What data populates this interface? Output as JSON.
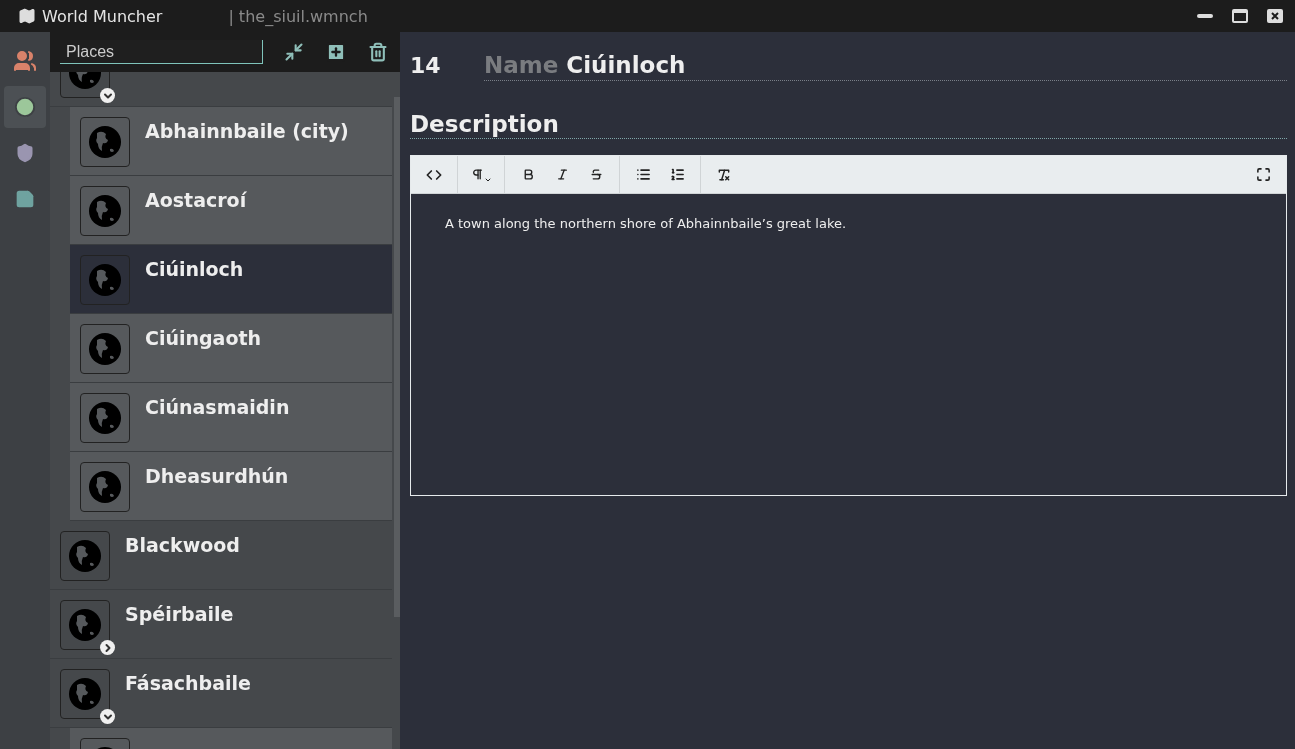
{
  "window": {
    "app_name": "World Muncher",
    "file_name": "| the_siuil.wmnch"
  },
  "rail": [
    {
      "kind": "people",
      "selected": false
    },
    {
      "kind": "places",
      "selected": true
    },
    {
      "kind": "factions",
      "selected": false
    },
    {
      "kind": "notes",
      "selected": false
    }
  ],
  "panel": {
    "search": {
      "value": "Places"
    }
  },
  "places": [
    {
      "expanded": true,
      "selected": false,
      "children": [
        {
          "name": "Abhainnbaile (city)",
          "selected": false
        },
        {
          "name": "Aostacroí",
          "selected": false
        },
        {
          "name": "Ciúinloch",
          "selected": true
        },
        {
          "name": "Ciúingaoth",
          "selected": false
        },
        {
          "name": "Ciúnasmaidin",
          "selected": false
        },
        {
          "name": "Dheasurdhún",
          "selected": false
        }
      ]
    },
    {
      "name": "Blackwood",
      "selected": false
    },
    {
      "name": "Spéirbaile",
      "expanded": false,
      "selected": false
    },
    {
      "name": "Fásachbaile",
      "expanded": true,
      "selected": false,
      "children": [
        {
          "selected": false
        }
      ]
    }
  ],
  "detail": {
    "id": "14",
    "name_label": "Name",
    "name": "Ciúinloch",
    "description_heading": "Description",
    "description": "A town along the northern shore of Abhainnbaile’s great lake."
  }
}
